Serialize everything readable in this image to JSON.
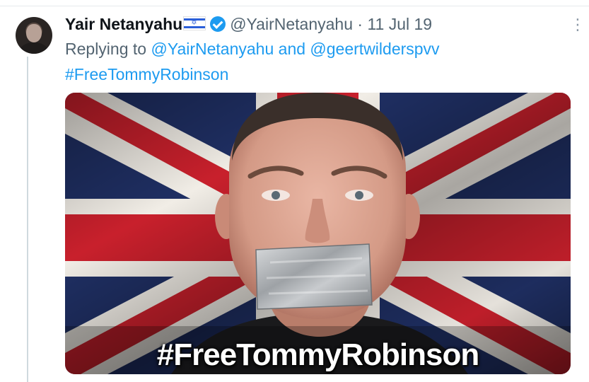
{
  "tweet": {
    "author_name": "Yair Netanyahu",
    "author_flag": "israel-flag-icon",
    "verified": "verified-badge-icon",
    "handle": "@YairNetanyahu",
    "separator": "·",
    "date": "11 Jul 19",
    "replying_prefix": "Replying to",
    "replying_to_1": "@YairNetanyahu",
    "replying_conjunction": "and",
    "replying_to_2": "@geertwilderspvv",
    "hashtag": "#FreeTommyRobinson",
    "media_caption": "#FreeTommyRobinson",
    "more_icon": "more-options-icon"
  },
  "colors": {
    "link": "#1d9bf0",
    "secondary_text": "#536471",
    "primary_text": "#0f1419",
    "flag_blue": "#1d2b5c",
    "flag_red": "#c8202c"
  }
}
